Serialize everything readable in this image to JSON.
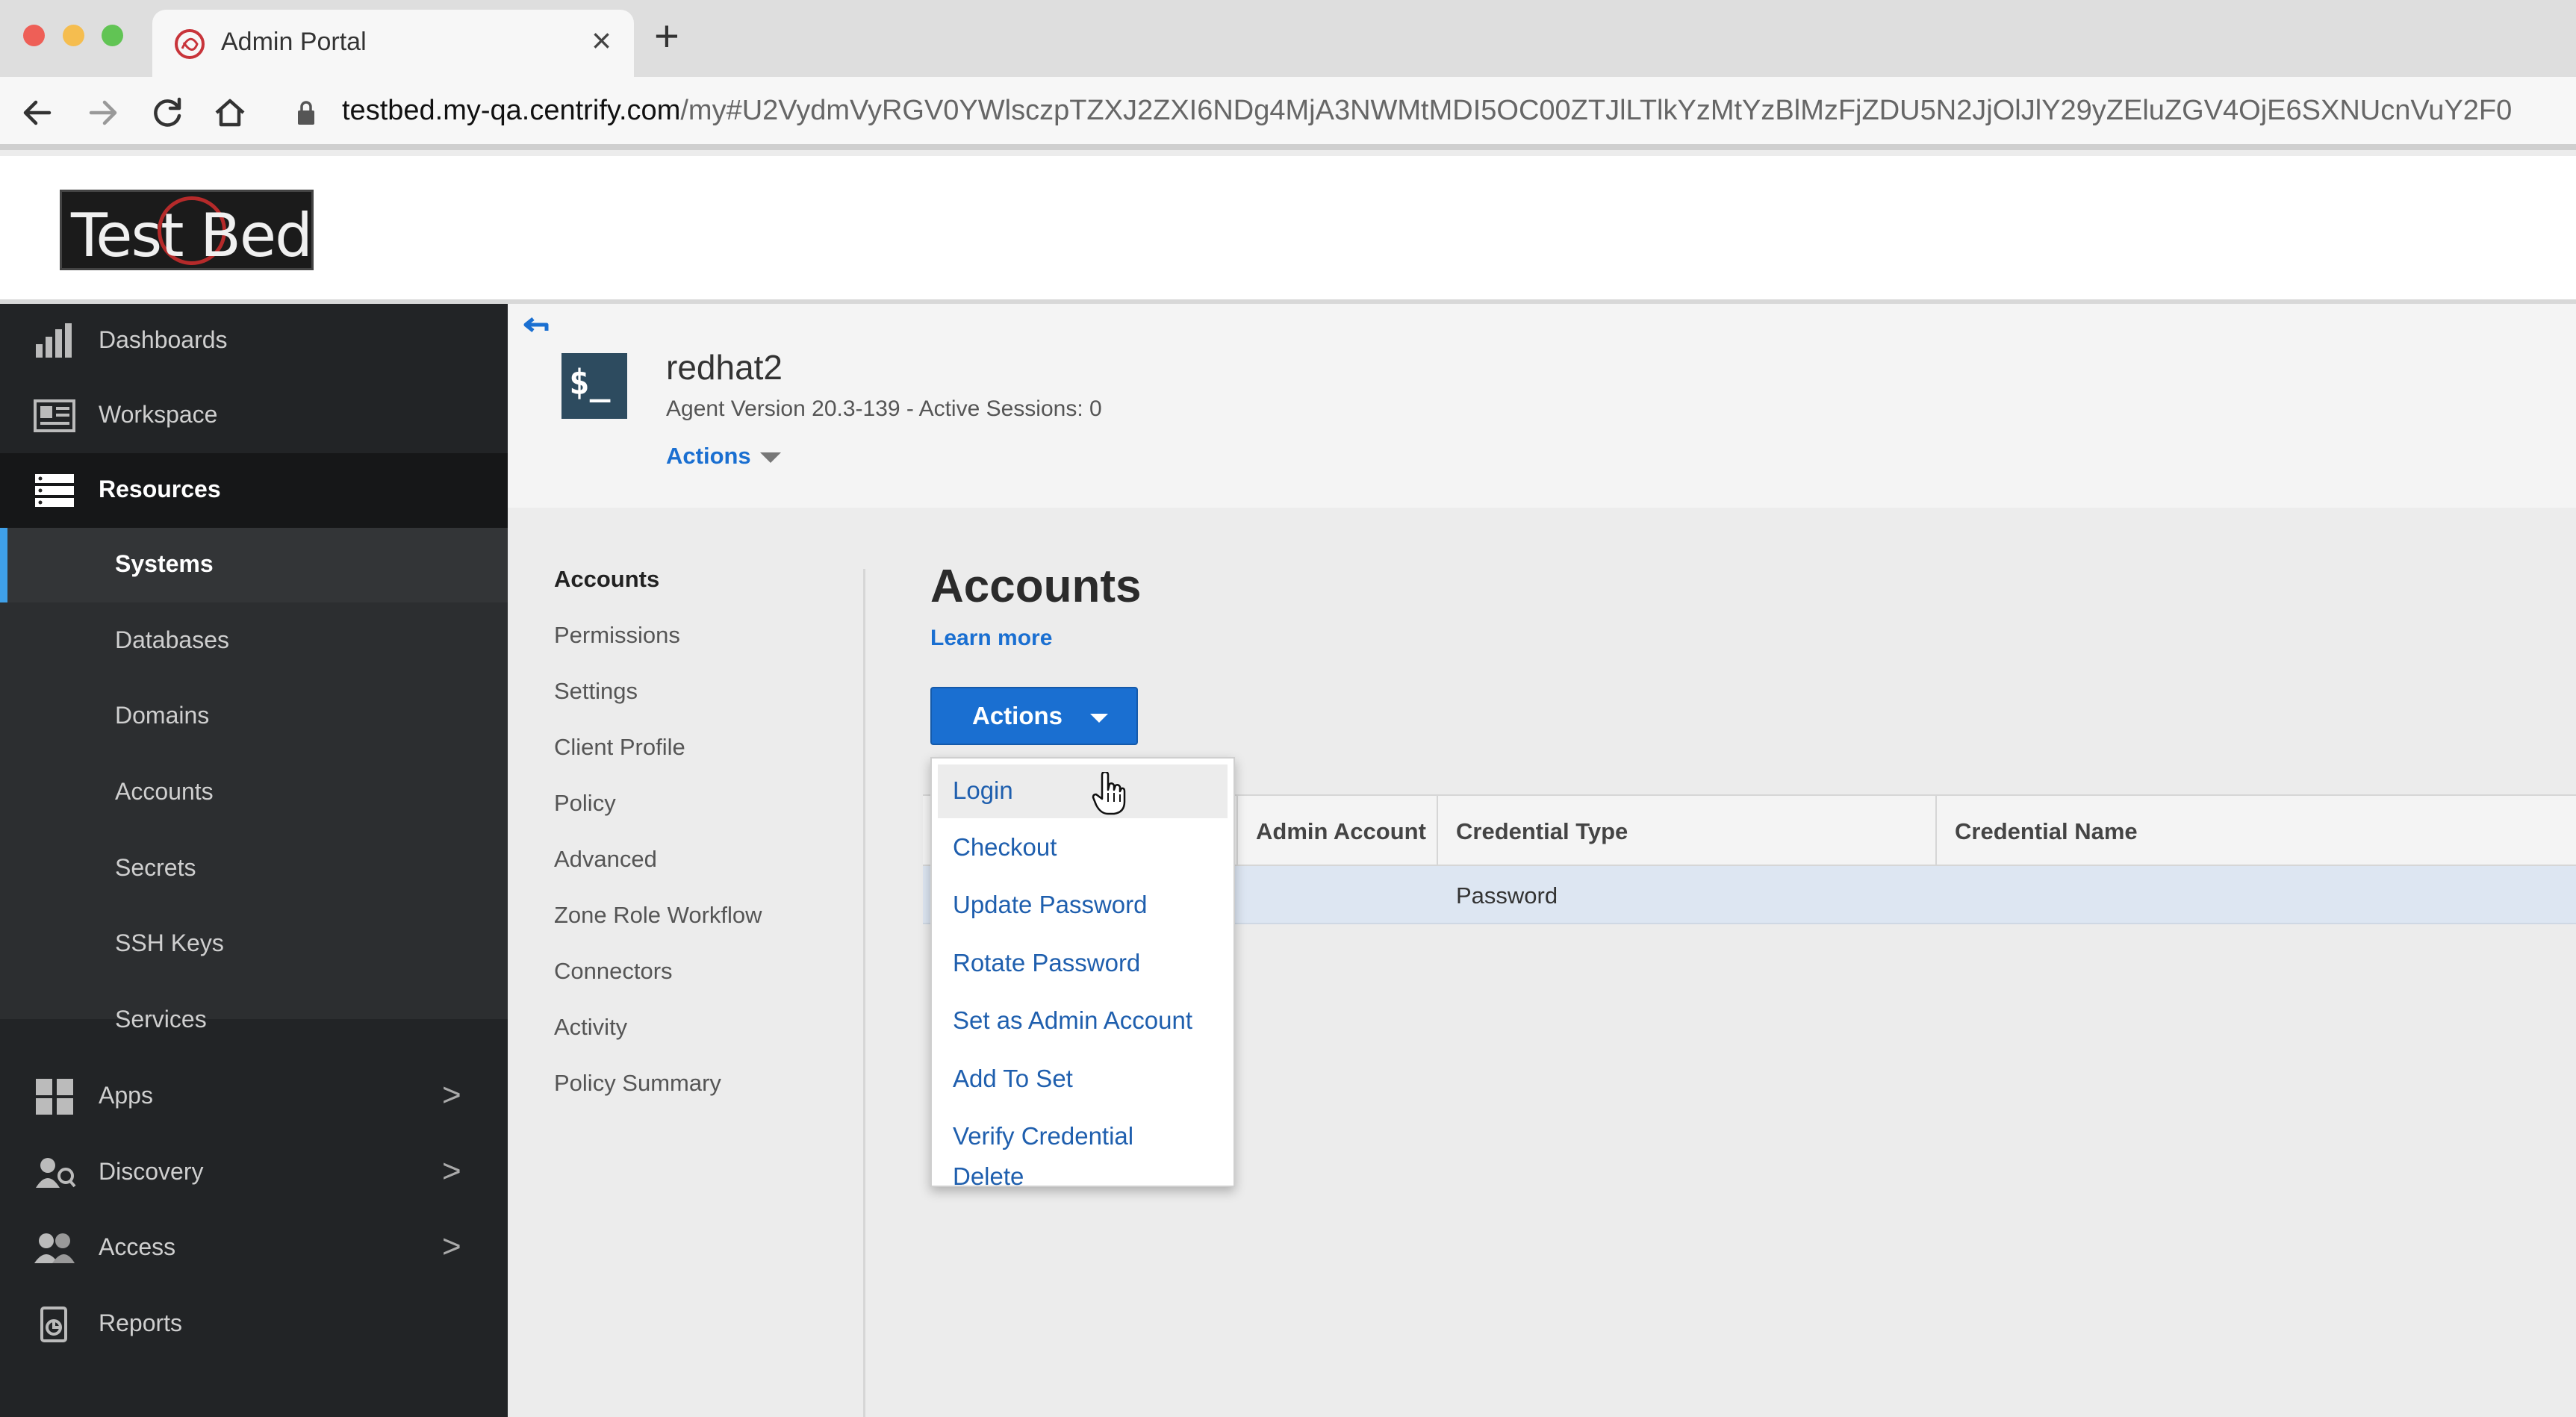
{
  "browser": {
    "tab_title": "Admin Portal",
    "close_glyph": "×",
    "new_tab_glyph": "+",
    "url_host": "testbed.my-qa.centrify.com",
    "url_path": "/my#U2VydmVyRGV0YWlsczpTZXJ2ZXI6NDg4MjA3NWMtMDI5OC00ZTJlLTlkYzMtYzBlMzFjZDU5N2JjOlJlY29yZEluZGV4OjE6SXNUcnVuY2F0"
  },
  "header": {
    "logo_text": "Test Bed"
  },
  "sidebar": {
    "items": [
      {
        "label": "Dashboards",
        "icon": "bar-chart-icon"
      },
      {
        "label": "Workspace",
        "icon": "workspace-icon"
      },
      {
        "label": "Resources",
        "icon": "resources-icon",
        "active": true
      },
      {
        "label": "Apps",
        "icon": "apps-grid-icon",
        "chevron": ">"
      },
      {
        "label": "Discovery",
        "icon": "discovery-icon",
        "chevron": ">"
      },
      {
        "label": "Access",
        "icon": "users-icon",
        "chevron": ">"
      },
      {
        "label": "Reports",
        "icon": "reports-icon"
      }
    ],
    "resources_sub": [
      "Systems",
      "Databases",
      "Domains",
      "Accounts",
      "Secrets",
      "SSH Keys",
      "Services"
    ],
    "selected_sub": "Systems"
  },
  "system": {
    "icon_text": "$_",
    "name": "redhat2",
    "subtitle": "Agent Version 20.3-139 - Active Sessions: 0",
    "actions_label": "Actions"
  },
  "subnav": {
    "items": [
      "Accounts",
      "Permissions",
      "Settings",
      "Client Profile",
      "Policy",
      "Advanced",
      "Zone Role Workflow",
      "Connectors",
      "Activity",
      "Policy Summary"
    ],
    "current": "Accounts"
  },
  "main": {
    "title": "Accounts",
    "learn_more": "Learn more",
    "actions_button": "Actions",
    "columns": [
      "Admin Account",
      "Credential Type",
      "Credential Name"
    ],
    "row": {
      "credential_type": "Password"
    }
  },
  "dropdown": {
    "items": [
      "Login",
      "Checkout",
      "Update Password",
      "Rotate Password",
      "Set as Admin Account",
      "Add To Set",
      "Verify Credential",
      "Delete"
    ],
    "hovered": "Login"
  },
  "colors": {
    "accent": "#1a6fd1",
    "sidebar_bg": "#222426",
    "sidebar_selected_bar": "#3fa0e8"
  }
}
